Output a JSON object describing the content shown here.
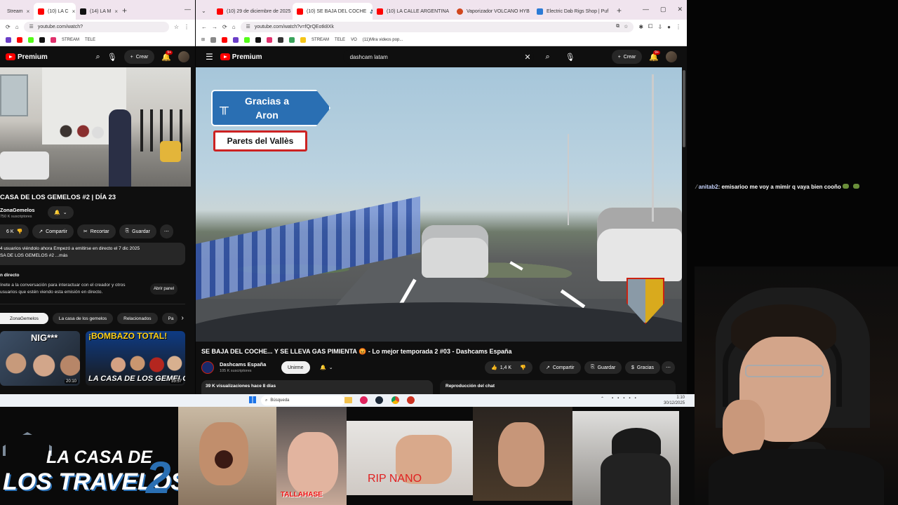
{
  "left_window": {
    "tabs": [
      {
        "label": "Stream",
        "active": false
      },
      {
        "label": "(10) LA C",
        "active": true
      },
      {
        "label": "(14) LA M",
        "active": false
      }
    ],
    "address": "youtube.com/watch?",
    "bookmarks": [
      "STREAM",
      "TELE"
    ],
    "header": {
      "logo": "Premium",
      "create": "Crear",
      "notif_count": "9+"
    },
    "video": {
      "title": "CASA DE LOS GEMELOS #2 | DÍA 23",
      "channel": "ZonaGemelos",
      "subs": "750 K suscriptores",
      "likes": "6 K",
      "actions": [
        "Compartir",
        "Recortar",
        "Guardar"
      ],
      "desc_line1": "4 usuarios viéndolo ahora  Empezó a emitirse en directo el 7 dic 2025",
      "desc_line2": "SA DE LOS GEMELOS #2 ...más",
      "live_title": "n directo",
      "live_line1": "ínete a la conversación para interactuar con el creador y otros",
      "live_line2": "usuarios que estén viendo esta emisión en directo.",
      "open_panel": "Abrir panel",
      "chips": [
        "ZonaGemelos",
        "La casa de los gemelos",
        "Relacionados",
        "Pa"
      ],
      "thumbs": [
        {
          "text": "NIG***",
          "time": "20:10"
        },
        {
          "text": "¡BOMBAZO TOTAL!",
          "sub": "LA CASA DE LOS GEMELOS",
          "time": "33:57"
        }
      ]
    }
  },
  "right_window": {
    "tabs": [
      {
        "label": "(10) 29 de diciembre de 2025",
        "active": false
      },
      {
        "label": "(10) SE BAJA DEL COCHE",
        "active": true
      },
      {
        "label": "(10) LA CALLE ARGENTINA",
        "active": false
      },
      {
        "label": "Vaporizador VOLCANO HYB",
        "active": false
      },
      {
        "label": "Electric Dab Rigs Shop | Puf",
        "active": false
      }
    ],
    "address": "youtube.com/watch?v=fQrQEotk8Xk",
    "bookmarks": [
      "STREAM",
      "TELE",
      "VO",
      "(11)Mira videos pop..."
    ],
    "header": {
      "logo": "Premium",
      "search_value": "dashcam latam",
      "create": "Crear",
      "notif_count": "9+"
    },
    "video": {
      "sign_top": "Gracias a\nAron",
      "sign_bottom": "Parets del Vallès",
      "title": "SE BAJA DEL COCHE... Y SE LLEVA GAS PIMIENTA 😡 - Lo mejor temporada 2 #03 - Dashcams España",
      "channel": "Dashcams España",
      "subs": "105 K suscriptores",
      "join": "Unirme",
      "likes": "1,4 K",
      "share": "Compartir",
      "save": "Guardar",
      "thanks": "Gracias",
      "views": "39 K visualizaciones  hace 8 días",
      "chat_replay": "Reproducción del chat"
    }
  },
  "taskbar": {
    "search": "Búsqueda",
    "time": "1:10",
    "date": "30/12/2025"
  },
  "chat": {
    "user": "anitab2",
    "message": ": emisarioo me voy a mimir q vaya bien cooño"
  },
  "overlays": {
    "logo_text1": "LA CASA DE",
    "logo_text2": "LOS TRAVELOS",
    "logo_num": "2",
    "cam_captions": [
      "TALLAHASE",
      "RIP NANO"
    ]
  },
  "colors": {
    "yt_bg": "#0f0f0f",
    "yt_red": "#ff0000",
    "chrome_tab": "#f0e4ee",
    "sign_blue": "#2a6fb3"
  }
}
